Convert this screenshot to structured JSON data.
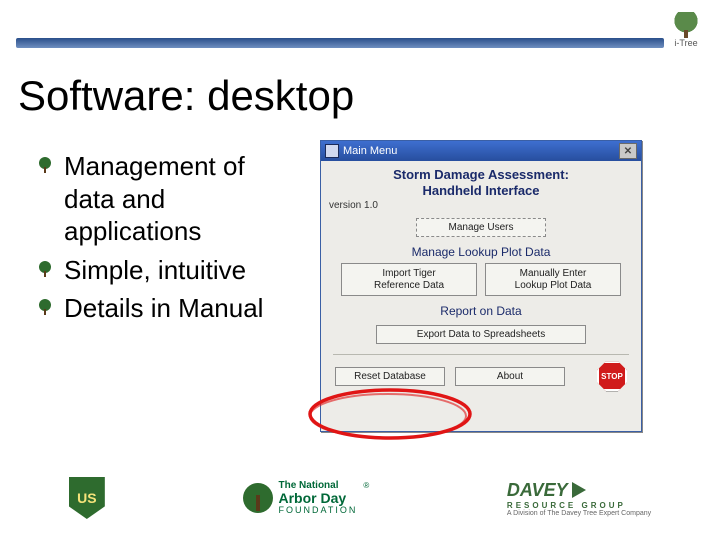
{
  "header": {
    "logo_caption": "i-Tree"
  },
  "title": "Software: desktop",
  "bullets": {
    "items": [
      "Management of data and applications",
      "Simple, intuitive",
      "Details in Manual"
    ]
  },
  "app": {
    "window_title": "Main Menu",
    "heading_line1": "Storm Damage Assessment:",
    "heading_line2": "Handheld Interface",
    "version": "version 1.0",
    "manage_users_btn": "Manage Users",
    "section_lookup": "Manage Lookup Plot Data",
    "import_tiger_btn": "Import Tiger\nReference Data",
    "manual_lookup_btn": "Manually Enter\nLookup Plot Data",
    "section_report": "Report on Data",
    "export_btn": "Export Data to Spreadsheets",
    "reset_btn": "Reset Database",
    "about_btn": "About",
    "stop_label": "STOP"
  },
  "footer": {
    "arbor_line1": "The National",
    "arbor_line2": "Arbor Day",
    "arbor_line3": "FOUNDATION",
    "davey_line1": "DAVEY",
    "davey_line2": "RESOURCE GROUP",
    "davey_line3": "A Division of The Davey Tree Expert Company"
  }
}
